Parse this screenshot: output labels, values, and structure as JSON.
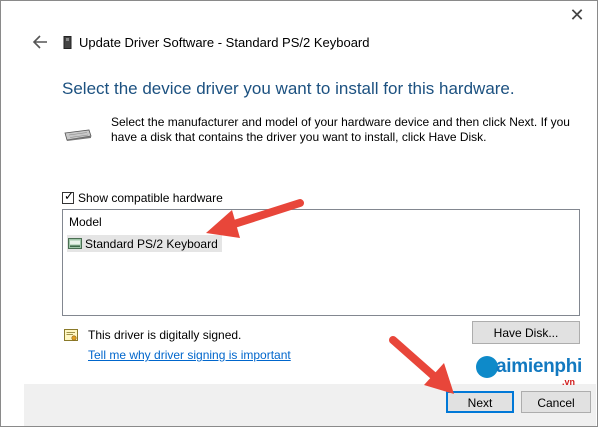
{
  "window": {
    "title": "Update Driver Software - Standard PS/2 Keyboard",
    "close_glyph": "✕"
  },
  "heading": "Select the device driver you want to install for this hardware.",
  "description": "Select the manufacturer and model of your hardware device and then click Next. If you have a disk that contains the driver you want to install, click Have Disk.",
  "compatible": {
    "label": "Show compatible hardware",
    "checked": true
  },
  "model_list": {
    "header": "Model",
    "items": [
      {
        "label": "Standard PS/2 Keyboard",
        "selected": true
      }
    ]
  },
  "signing": {
    "status": "This driver is digitally signed.",
    "link": "Tell me why driver signing is important"
  },
  "buttons": {
    "have_disk": "Have Disk...",
    "next": "Next",
    "cancel": "Cancel"
  },
  "watermark": {
    "brand": "aimienphi",
    "domain": ".vn"
  },
  "colors": {
    "heading": "#1c5180",
    "link": "#0066cc",
    "annotation_arrow": "#e8463a",
    "focus_border": "#0078d7"
  },
  "icons": {
    "back": "back-arrow-icon",
    "title": "device-icon",
    "keyboard": "keyboard-icon",
    "item": "keyboard-device-icon",
    "certificate": "certificate-icon"
  }
}
